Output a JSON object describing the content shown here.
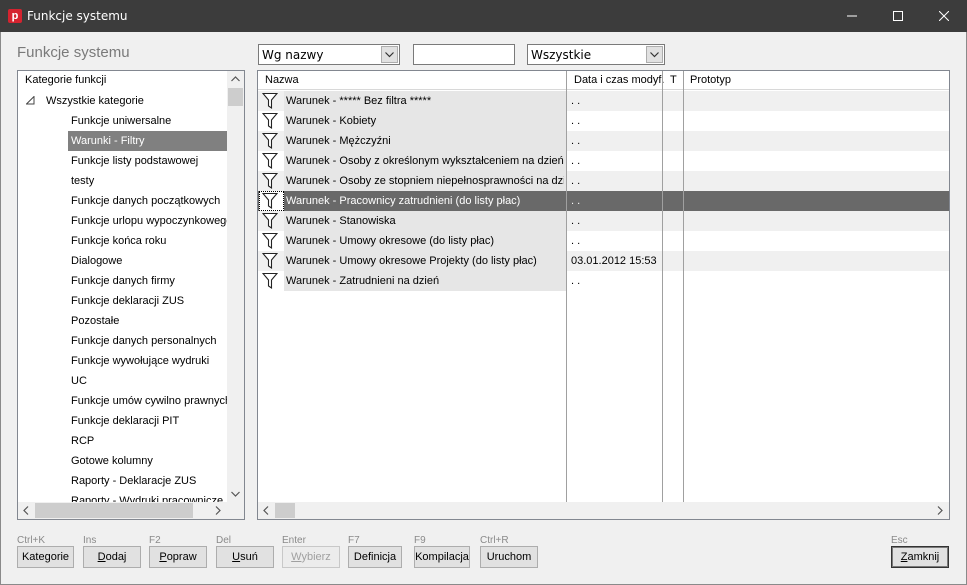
{
  "window": {
    "title": "Funkcje systemu",
    "app_icon_letter": "p"
  },
  "header": {
    "title": "Funkcje systemu"
  },
  "toolbar": {
    "sort_value": "Wg nazwy",
    "search_value": "",
    "filter_value": "Wszystkie"
  },
  "tree": {
    "header": "Kategorie funkcji",
    "root": "Wszystkie kategorie",
    "items": [
      "Funkcje uniwersalne",
      "Warunki - Filtry",
      "Funkcje listy podstawowej",
      "testy",
      "Funkcje danych początkowych",
      "Funkcje urlopu wypoczynkowego",
      "Funkcje końca roku",
      "Dialogowe",
      "Funkcje danych firmy",
      "Funkcje deklaracji ZUS",
      "Pozostałe",
      "Funkcje danych personalnych",
      "Funkcje wywołujące wydruki",
      "UC",
      "Funkcje umów cywilno prawnych",
      "Funkcje deklaracji PIT",
      "RCP",
      "Gotowe kolumny",
      "Raporty - Deklaracje ZUS",
      "Raporty - Wydruki pracownicze"
    ],
    "selected_index": 1
  },
  "grid": {
    "columns": [
      "Nazwa",
      "Data i czas modyf.",
      "T",
      "Prototyp"
    ],
    "rows": [
      {
        "name": "Warunek - ***** Bez filtra *****",
        "date": ". ."
      },
      {
        "name": "Warunek - Kobiety",
        "date": ". ."
      },
      {
        "name": "Warunek - Mężczyźni",
        "date": ". ."
      },
      {
        "name": "Warunek - Osoby z określonym wykształceniem na dzień",
        "date": ". ."
      },
      {
        "name": "Warunek - Osoby ze stopniem niepełnosprawności na dzień",
        "date": ". ."
      },
      {
        "name": "Warunek - Pracownicy zatrudnieni (do listy płac)",
        "date": ". ."
      },
      {
        "name": "Warunek - Stanowiska",
        "date": ". ."
      },
      {
        "name": "Warunek - Umowy okresowe (do listy płac)",
        "date": ". ."
      },
      {
        "name": "Warunek - Umowy okresowe Projekty (do listy płac)",
        "date": "03.01.2012 15:53"
      },
      {
        "name": "Warunek - Zatrudnieni na dzień",
        "date": ". ."
      }
    ],
    "selected_index": 5
  },
  "buttons": [
    {
      "shortcut": "Ctrl+K",
      "label": "Kategorie",
      "accel": "",
      "disabled": false
    },
    {
      "shortcut": "Ins",
      "label": "Dodaj",
      "accel": "D",
      "disabled": false
    },
    {
      "shortcut": "F2",
      "label": "Popraw",
      "accel": "P",
      "disabled": false
    },
    {
      "shortcut": "Del",
      "label": "Usuń",
      "accel": "U",
      "disabled": false
    },
    {
      "shortcut": "Enter",
      "label": "Wybierz",
      "accel": "W",
      "disabled": true
    },
    {
      "shortcut": "F7",
      "label": "Definicja",
      "accel": "",
      "disabled": false
    },
    {
      "shortcut": "F9",
      "label": "Kompilacja",
      "accel": "",
      "disabled": false
    },
    {
      "shortcut": "Ctrl+R",
      "label": "Uruchom",
      "accel": "",
      "disabled": false
    },
    {
      "shortcut": "Esc",
      "label": "Zamknij",
      "accel": "Z",
      "disabled": false
    }
  ],
  "colors": {
    "titlebar": "#3c3c3c",
    "selection": "#696969",
    "app_icon": "#d5232f"
  }
}
